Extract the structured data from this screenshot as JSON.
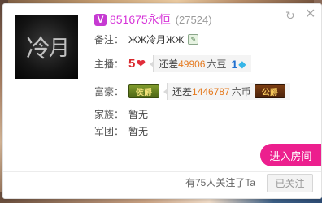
{
  "profile": {
    "nickname": "851675永恒",
    "uid_text": "(27524)",
    "vip_badge": "V",
    "colors": {
      "nickname": "#d633d8",
      "enter_button": "#ec1f8e",
      "diff_value": "#e57a1f"
    }
  },
  "remark": {
    "label": "备注：",
    "value": "ЖЖ冷月ЖЖ"
  },
  "anchor": {
    "label": "主播：",
    "level": "5",
    "level_icon": "heart-icon",
    "diff_prefix": "还差",
    "diff_value": "49906",
    "diff_unit": "六豆",
    "next_level": "1",
    "next_level_icon": "diamond-icon"
  },
  "wealth": {
    "label": "富豪：",
    "current_badge": "侯爵",
    "diff_prefix": "还差",
    "diff_value": "1446787",
    "diff_unit": "六币",
    "next_badge": "公爵"
  },
  "family": {
    "label": "家族：",
    "value": "暂无"
  },
  "army": {
    "label": "军团：",
    "value": "暂无"
  },
  "actions": {
    "enter_room": "进入房间",
    "follow_button": "已关注"
  },
  "followers_text": "有75人关注了Ta"
}
